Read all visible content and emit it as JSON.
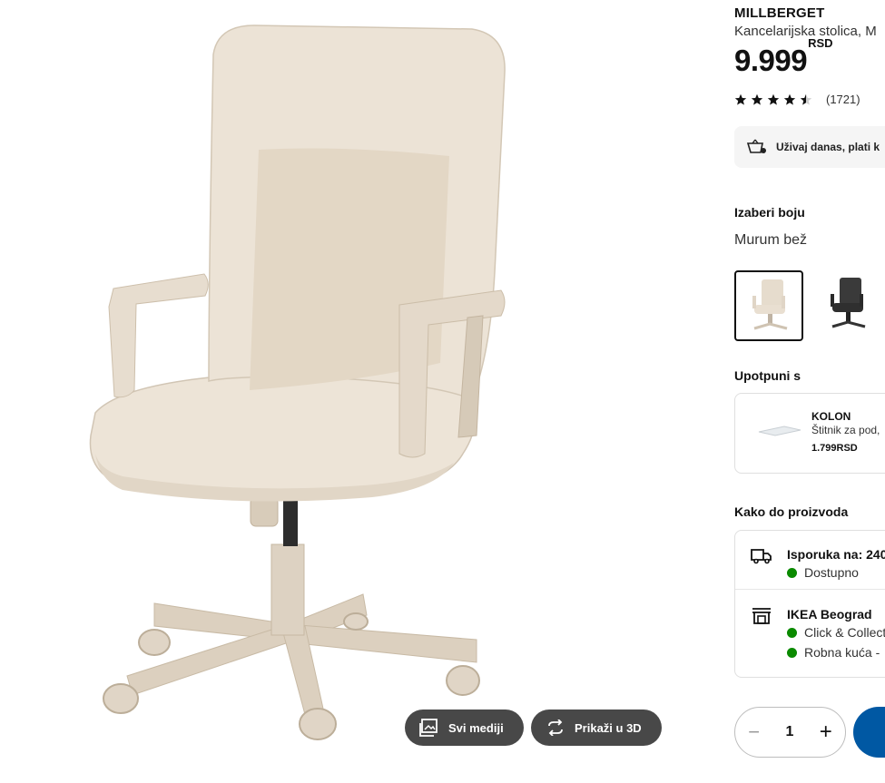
{
  "product": {
    "brand": "MILLBERGET",
    "subtitle": "Kancelarijska stolica, M",
    "price_value": "9.999",
    "price_currency": "RSD",
    "rating_stars": 4.5,
    "rating_count": "(1721)"
  },
  "banner": {
    "text": "Uživaj danas, plati k",
    "icon": "basket-pay-icon"
  },
  "color_section": {
    "heading": "Izaberi boju",
    "selected_name": "Murum bež",
    "swatches": [
      {
        "name": "beige",
        "color": "#e6dccd",
        "selected": true
      },
      {
        "name": "black",
        "color": "#333333",
        "selected": false
      }
    ]
  },
  "complete_section": {
    "heading": "Upotpuni s",
    "item": {
      "name": "KOLON",
      "desc": "Štitnik za pod,",
      "price": "1.799RSD"
    }
  },
  "availability_section": {
    "heading": "Kako do proizvoda",
    "delivery": {
      "title": "Isporuka na: 240",
      "status": "Dostupno",
      "icon": "truck-icon"
    },
    "store": {
      "title": "IKEA Beograd",
      "click_collect": "Click & Collect",
      "store_status": "Robna kuća -",
      "icon": "store-icon"
    }
  },
  "cart": {
    "quantity": "1",
    "minus": "−",
    "plus": "+"
  },
  "media_buttons": {
    "all_media": "Svi mediji",
    "view_3d": "Prikaži u 3D"
  },
  "colors": {
    "chair_light": "#ece2d4",
    "chair_mid": "#e0d4c3",
    "chair_dark": "#cdbfac",
    "status_green": "#0a8a00",
    "ikea_blue": "#0058a3",
    "pill_bg": "#484848"
  }
}
